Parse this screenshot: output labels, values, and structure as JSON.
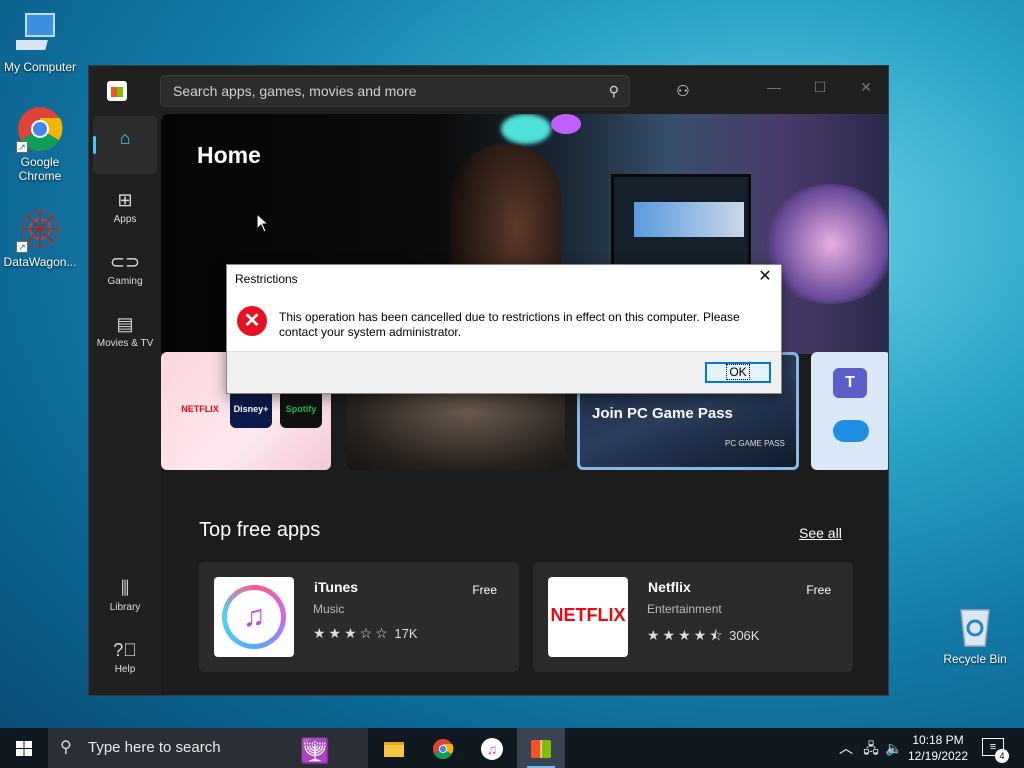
{
  "desktop": {
    "icons": [
      {
        "label": "My Computer"
      },
      {
        "label": "Google Chrome"
      },
      {
        "label": "DataWagon..."
      },
      {
        "label": "Recycle Bin"
      }
    ]
  },
  "store": {
    "search_placeholder": "Search apps, games, movies and more",
    "nav": [
      {
        "label": "Home",
        "icon": "home-icon"
      },
      {
        "label": "Apps",
        "icon": "apps-icon"
      },
      {
        "label": "Gaming",
        "icon": "gamepad-icon"
      },
      {
        "label": "Movies & TV",
        "icon": "film-icon"
      }
    ],
    "nav_bottom": [
      {
        "label": "Library",
        "icon": "library-icon"
      },
      {
        "label": "Help",
        "icon": "help-icon"
      }
    ],
    "page_title": "Home",
    "banner_cards": {
      "card1_tiles": [
        "NETFLIX",
        "Disney+",
        "Spotify"
      ],
      "card3_label": "Join PC Game Pass",
      "card3_sub": "PC GAME PASS"
    },
    "section_title": "Top free apps",
    "see_all": "See all",
    "apps": [
      {
        "name": "iTunes",
        "category": "Music",
        "rating": 3,
        "stars": "★★★☆☆",
        "reviews": "17K",
        "price": "Free"
      },
      {
        "name": "Netflix",
        "category": "Entertainment",
        "rating": 4.5,
        "stars": "★★★★⯪",
        "reviews": "306K",
        "price": "Free",
        "logo_text": "NETFLIX"
      }
    ]
  },
  "dialog": {
    "title": "Restrictions",
    "message": "This operation has been cancelled due to restrictions in effect on this computer. Please contact your system administrator.",
    "ok_label": "OK"
  },
  "taskbar": {
    "search_placeholder": "Type here to search",
    "time": "10:18 PM",
    "date": "12/19/2022",
    "notification_count": "4"
  },
  "colors": {
    "accent": "#4cc2ff",
    "error": "#e81123",
    "netflix": "#e50914"
  }
}
